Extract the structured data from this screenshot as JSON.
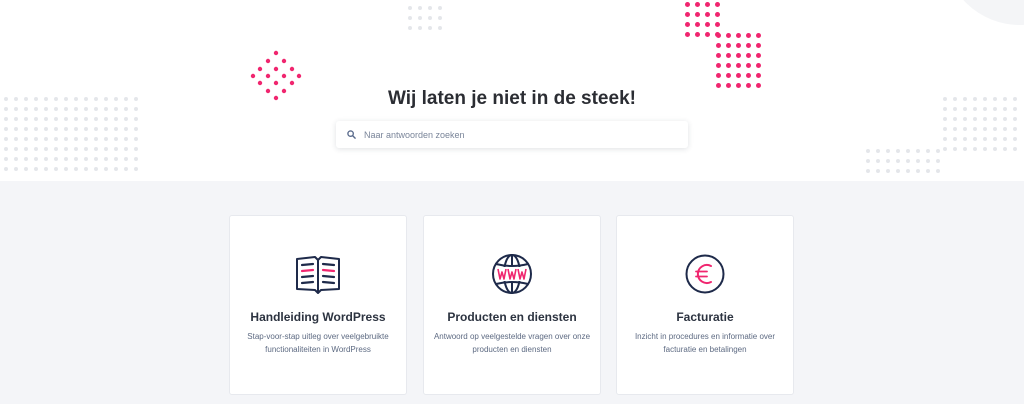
{
  "hero": {
    "title": "Wij laten je niet in de steek!"
  },
  "search": {
    "placeholder": "Naar antwoorden zoeken",
    "icon": "search-icon"
  },
  "colors": {
    "accent": "#f0266f",
    "icon_navy": "#1e2a4a",
    "title_text": "#2b2d33",
    "background_section": "#f4f5f8"
  },
  "categories": [
    {
      "icon": "book-icon",
      "title": "Handleiding WordPress",
      "description": "Stap-voor-stap uitleg over veelgebruikte functionaliteiten in WordPress"
    },
    {
      "icon": "globe-www-icon",
      "title": "Producten en diensten",
      "description": "Antwoord op veelgestelde vragen over onze producten en diensten"
    },
    {
      "icon": "euro-icon",
      "title": "Facturatie",
      "description": "Inzicht in procedures en informatie over facturatie en betalingen"
    }
  ]
}
